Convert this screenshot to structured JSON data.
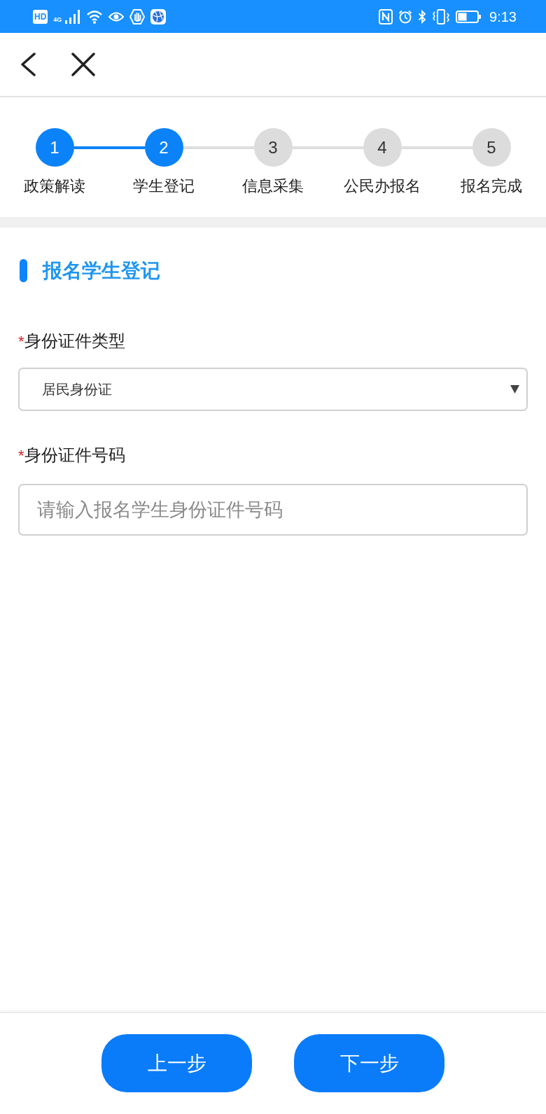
{
  "status_bar": {
    "hd_indicator": "HD",
    "network_type": "4G",
    "time": "9:13"
  },
  "stepper": [
    {
      "number": "1",
      "label": "政策解读",
      "active": true
    },
    {
      "number": "2",
      "label": "学生登记",
      "active": true
    },
    {
      "number": "3",
      "label": "信息采集",
      "active": false
    },
    {
      "number": "4",
      "label": "公民办报名",
      "active": false
    },
    {
      "number": "5",
      "label": "报名完成",
      "active": false
    }
  ],
  "section": {
    "title": "报名学生登记"
  },
  "fields": [
    {
      "kind": "select",
      "required_mark": "*",
      "label": "身份证件类型",
      "value": "居民身份证"
    },
    {
      "kind": "input",
      "required_mark": "*",
      "label": "身份证件号码",
      "placeholder": "请输入报名学生身份证件号码"
    }
  ],
  "buttons": [
    {
      "label": "上一步"
    },
    {
      "label": "下一步"
    }
  ]
}
